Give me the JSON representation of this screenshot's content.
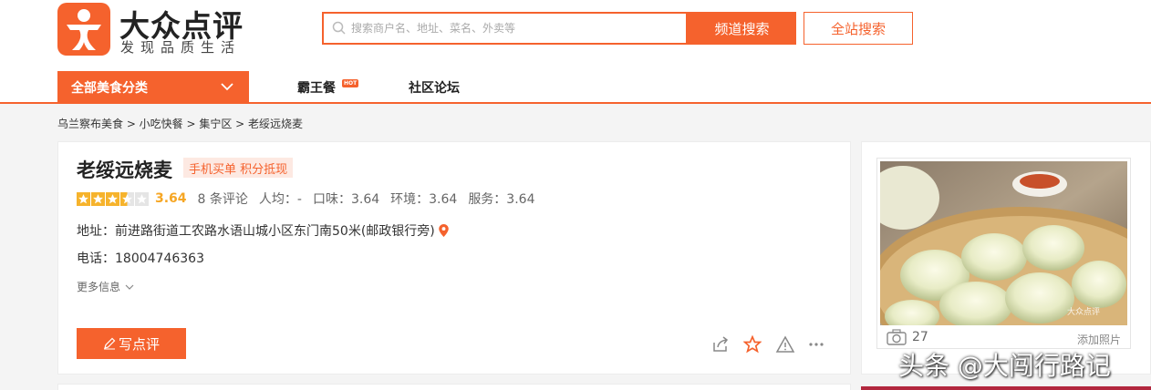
{
  "brand": {
    "name": "大众点评",
    "slogan": "发现品质生活",
    "color": "#f5622d"
  },
  "search": {
    "placeholder": "搜索商户名、地址、菜名、外卖等",
    "channel_button": "频道搜索",
    "site_button": "全站搜索"
  },
  "nav": {
    "category_label": "全部美食分类",
    "items": [
      {
        "label": "霸王餐",
        "badge": "HOT"
      },
      {
        "label": "社区论坛"
      }
    ]
  },
  "breadcrumb": "乌兰察布美食 > 小吃快餐 > 集宁区 > 老绥远烧麦",
  "shop": {
    "name": "老绥远烧麦",
    "tag": "手机买单 积分抵现",
    "rating": {
      "stars": 3.5,
      "score": "3.64",
      "reviews": "8 条评论",
      "avg_price": "人均：-",
      "taste": "口味：3.64",
      "environment": "环境：3.64",
      "service": "服务：3.64"
    },
    "address": "地址：前进路街道工农路水语山城小区东门南50米(邮政银行旁)",
    "phone": "电话：18004746363",
    "more_info": "更多信息",
    "write_review": "写点评",
    "actions": [
      "share-icon",
      "favorite-star-icon",
      "report-warning-icon",
      "more-dots-icon"
    ]
  },
  "photo": {
    "count": "27",
    "add_label": "添加照片",
    "image_watermark": "大众点评"
  },
  "watermark": "头条 @大闯行路记"
}
